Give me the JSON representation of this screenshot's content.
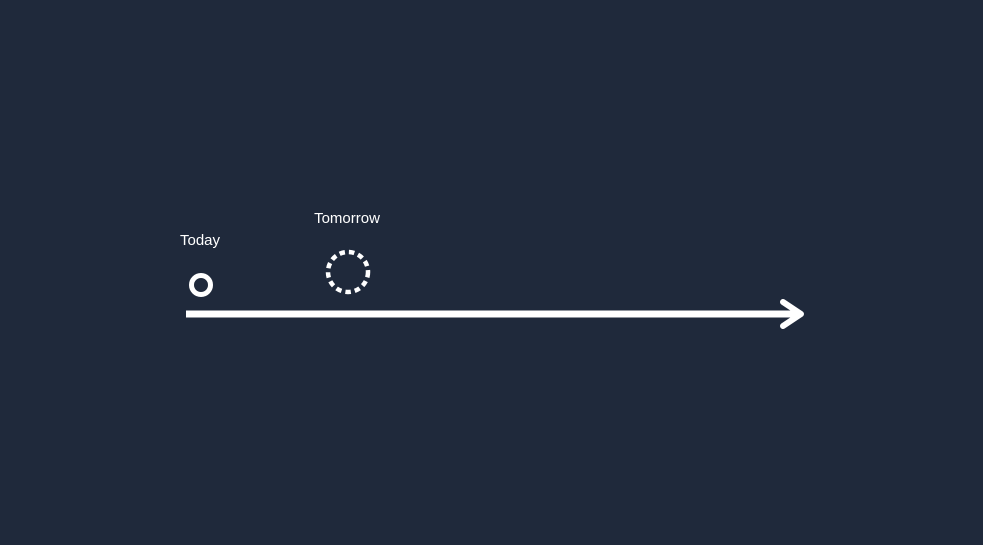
{
  "colors": {
    "background": "#1f293b",
    "foreground": "#ffffff"
  },
  "timeline": {
    "direction": "left-to-right",
    "arrowhead_icon": "arrow-right-icon",
    "markers": [
      {
        "label": "Today",
        "style": "solid-ring",
        "icon": "ring-icon"
      },
      {
        "label": "Tomorrow",
        "style": "dashed-ring",
        "icon": "dashed-ring-icon"
      }
    ]
  }
}
